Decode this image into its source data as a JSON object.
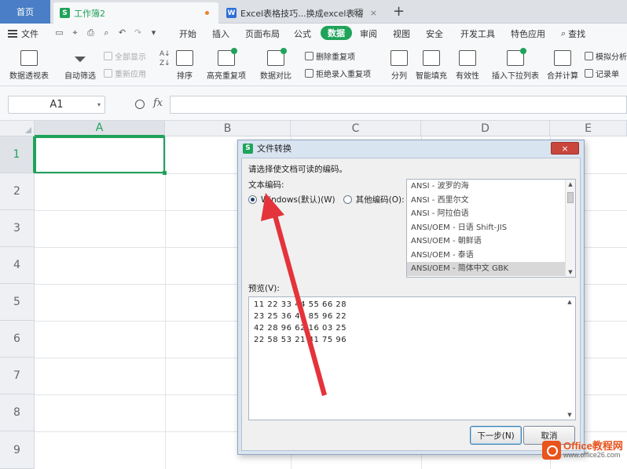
{
  "tabs": {
    "home": "首页",
    "workbook": "工作簿2",
    "doc": "Excel表格技巧...换成excel表格",
    "new_tab": "+"
  },
  "menu": {
    "file": "文件",
    "items": [
      "开始",
      "插入",
      "页面布局",
      "公式",
      "数据",
      "审阅",
      "视图",
      "安全",
      "开发工具",
      "特色应用"
    ],
    "active": "数据",
    "search": "查找"
  },
  "ribbon": {
    "pivot_table": "数据透视表",
    "auto_filter": "自动筛选",
    "show_all": "全部显示",
    "reapply": "重新应用",
    "sort": "排序",
    "highlight_dup": "高亮重复项",
    "data_compare": "数据对比",
    "remove_dup": "删除重复项",
    "reject_dup": "拒绝录入重复项",
    "split": "分列",
    "smart_fill": "智能填充",
    "validity": "有效性",
    "insert_dropdown": "插入下拉列表",
    "consolidate": "合并计算",
    "simulate": "模拟分析",
    "record": "记录单"
  },
  "formula_bar": {
    "cell_ref": "A1",
    "fx": "fx",
    "value": ""
  },
  "grid": {
    "columns": [
      "A",
      "B",
      "C",
      "D",
      "E"
    ],
    "rows": [
      "1",
      "2",
      "3",
      "4",
      "5",
      "6",
      "7",
      "8",
      "9"
    ],
    "selected_column": "A",
    "selected_row": "1"
  },
  "dialog": {
    "title": "文件转换",
    "close": "×",
    "prompt": "请选择使文档可读的编码。",
    "encoding_label": "文本编码:",
    "option_windows": "Windows(默认)(W)",
    "option_other": "其他编码(O):",
    "selected_option": "windows",
    "encodings": [
      "ANSI - 波罗的海",
      "ANSI - 西里尔文",
      "ANSI - 阿拉伯语",
      "ANSI/OEM - 日语 Shift-JIS",
      "ANSI/OEM - 朝鲜语",
      "ANSI/OEM - 泰语",
      "ANSI/OEM - 简体中文 GBK"
    ],
    "selected_encoding": "ANSI/OEM - 简体中文 GBK",
    "preview_label": "预览(V):",
    "preview_lines": [
      "11 22 33 44 55 66 28",
      "23 25 36 47 85 96 22",
      "42 28 96 62 16 03 25",
      "22 58 53 21 41 75 96"
    ],
    "next_button": "下一步(N)",
    "cancel_button": "取消"
  },
  "watermark": {
    "title": "Office教程网",
    "url": "www.office26.com"
  },
  "colors": {
    "accent": "#1fa35a",
    "annotation_arrow": "#e5333b",
    "dialog_close": "#c9463d"
  }
}
